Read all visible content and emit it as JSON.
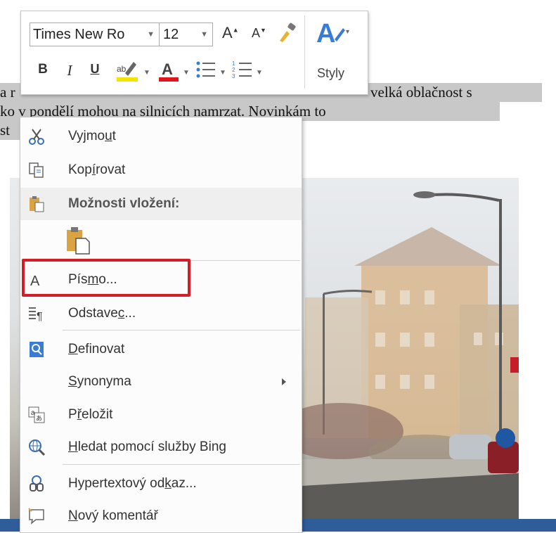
{
  "document": {
    "line1_left": "a r",
    "line1_right": "velká oblačnost s",
    "line2_left": "ko v pondělí mohou na silnicích ",
    "line2_underlined": "namrzat",
    "line2_right": ". Novinkám to",
    "line3_left": "st"
  },
  "mini_toolbar": {
    "font_name": "Times New Ro",
    "font_size": "12",
    "grow_font": "A",
    "shrink_font": "A",
    "bold": "B",
    "italic": "I",
    "underline": "U",
    "font_color_letter": "A",
    "styles_label": "Styly",
    "highlight_color": "#f2e600",
    "font_color": "#e0161c"
  },
  "context_menu": {
    "cut": {
      "before": "Vyjmo",
      "key": "u",
      "after": "t"
    },
    "copy": {
      "before": "Kop",
      "key": "í",
      "after": "rovat"
    },
    "paste_options": "Možnosti vložení:",
    "font": {
      "before": "Pís",
      "key": "m",
      "after": "o..."
    },
    "paragraph": {
      "before": "Odstave",
      "key": "c",
      "after": "..."
    },
    "define": {
      "key": "D",
      "after": "efinovat"
    },
    "synonyms": {
      "key": "S",
      "after": "ynonyma"
    },
    "translate": {
      "before": "P",
      "key": "ř",
      "after": "eložit"
    },
    "bing": {
      "key": "H",
      "after": "ledat pomocí služby Bing"
    },
    "hyperlink": {
      "before": "Hypertextový od",
      "key": "k",
      "after": "az..."
    },
    "comment": {
      "key": "N",
      "after": "ový komentář"
    }
  },
  "colors": {
    "highlight_border": "#d61d26",
    "selection_gray": "#c8c8c8",
    "bottom_bar": "#2f5d9a"
  }
}
